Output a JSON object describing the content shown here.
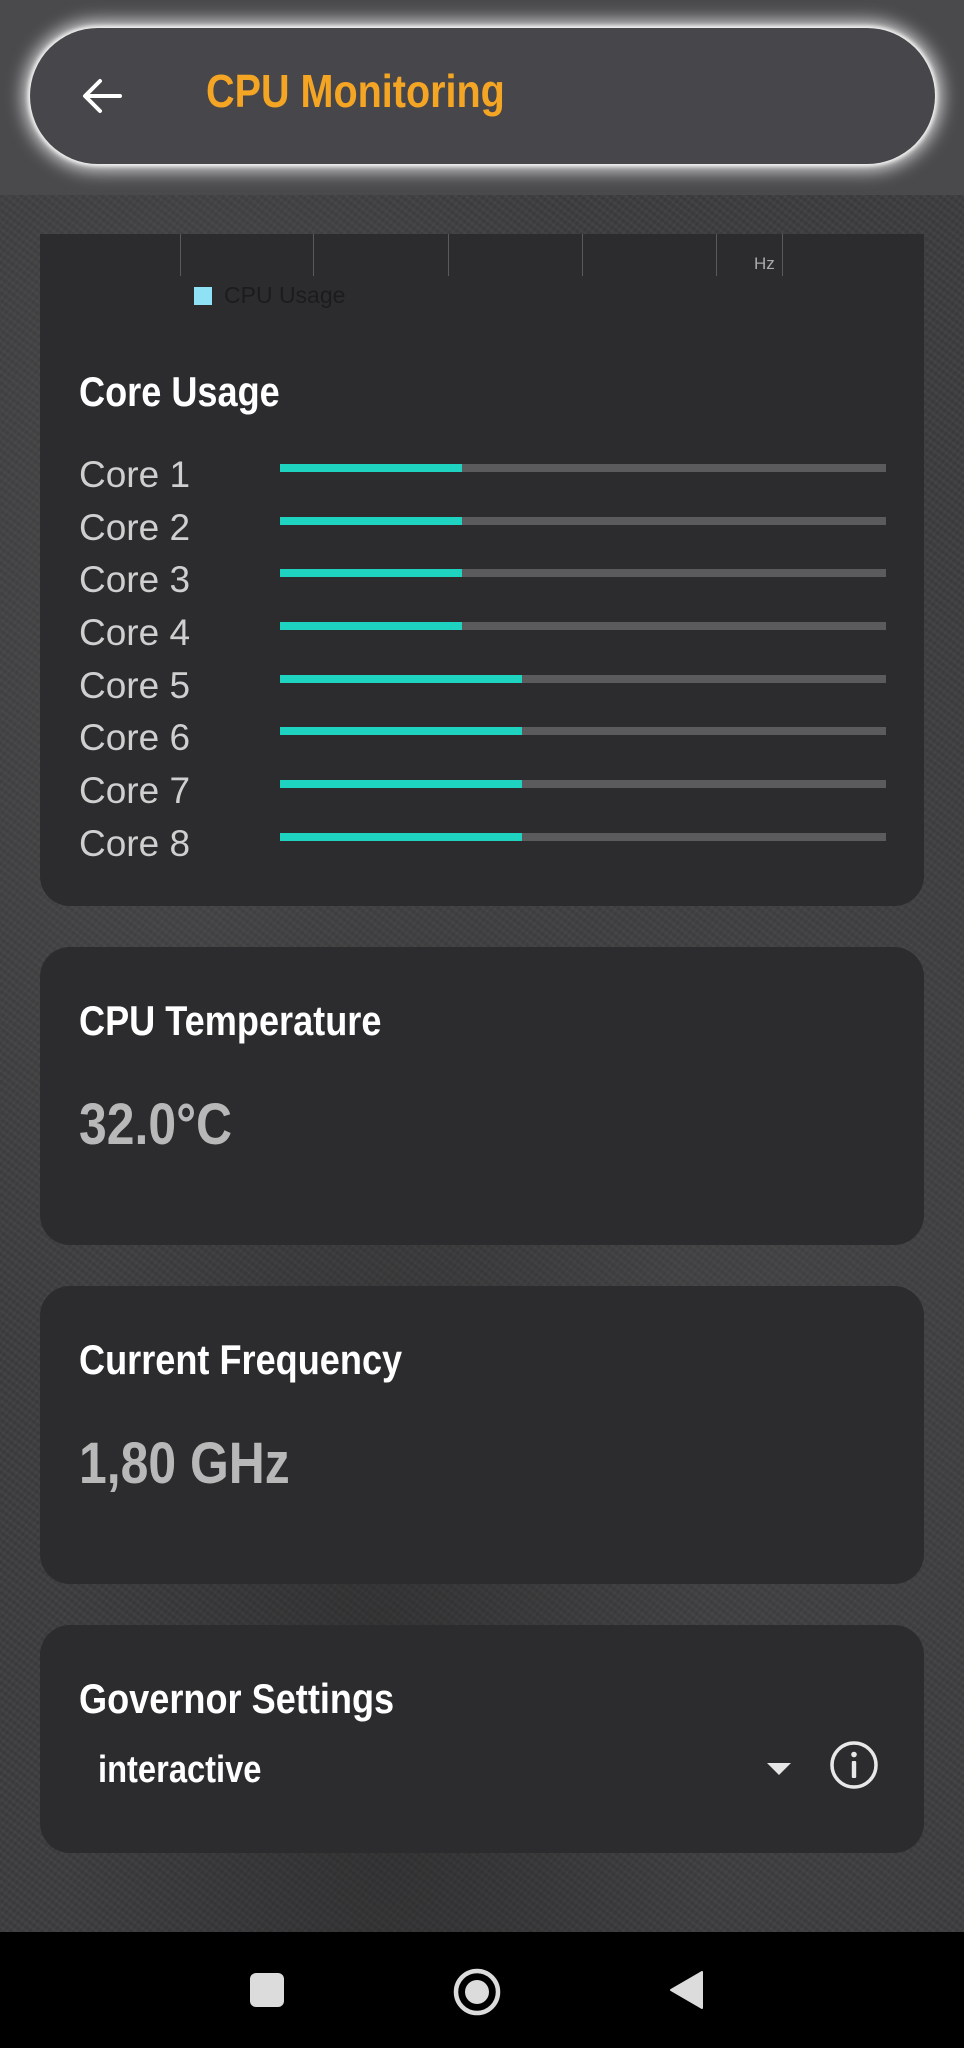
{
  "app_bar": {
    "title": "CPU Monitoring",
    "back_icon": "arrow-left-icon",
    "title_color": "#f5a524"
  },
  "chart": {
    "axis_unit": "Hz",
    "legend_label": "CPU Usage",
    "legend_color": "#8fe1f5"
  },
  "core_usage": {
    "title": "Core Usage",
    "bar_color": "#1ed3c0",
    "cores": [
      {
        "label": "Core 1",
        "usage": 0.3
      },
      {
        "label": "Core 2",
        "usage": 0.3
      },
      {
        "label": "Core 3",
        "usage": 0.3
      },
      {
        "label": "Core 4",
        "usage": 0.3
      },
      {
        "label": "Core 5",
        "usage": 0.4
      },
      {
        "label": "Core 6",
        "usage": 0.4
      },
      {
        "label": "Core 7",
        "usage": 0.4
      },
      {
        "label": "Core 8",
        "usage": 0.4
      }
    ]
  },
  "temperature": {
    "title": "CPU Temperature",
    "value": "32.0°C"
  },
  "frequency": {
    "title": "Current Frequency",
    "value": "1,80 GHz"
  },
  "governor": {
    "title": "Governor Settings",
    "selected": "interactive",
    "dropdown_icon": "caret-down-icon",
    "info_icon": "info-icon"
  },
  "nav": {
    "recents_icon": "square-icon",
    "home_icon": "circle-home-icon",
    "back_icon": "triangle-back-icon"
  }
}
